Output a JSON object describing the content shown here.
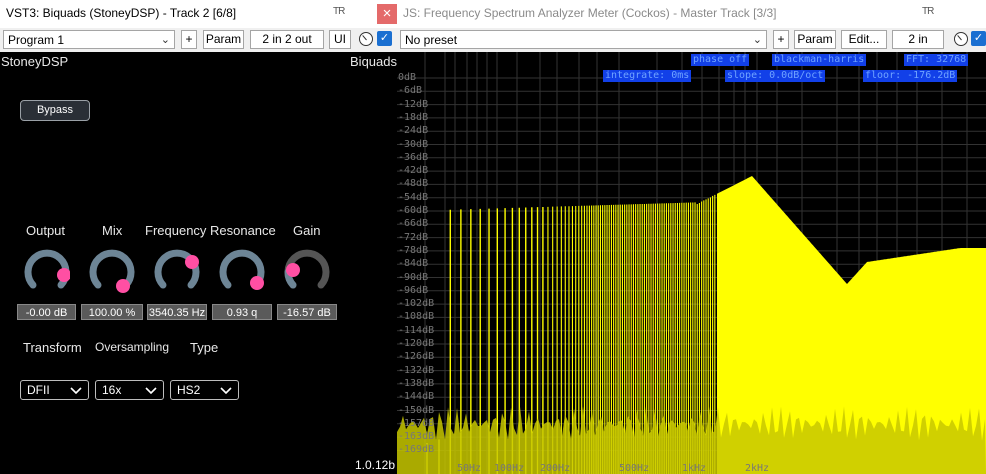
{
  "left_window": {
    "title": "VST3: Biquads (StoneyDSP) - Track 2 [6/8]",
    "pin_label": "TR",
    "close_label": "x",
    "program": "Program 1",
    "add_label": "+",
    "param_label": "Param",
    "io_label": "2 in 2 out",
    "ui_label": "UI",
    "vendor": "StoneyDSP",
    "plugin_name": "Biquads",
    "bypass_label": "Bypass",
    "knobs": [
      {
        "label": "Output",
        "value": "-0.00 dB"
      },
      {
        "label": "Mix",
        "value": "100.00 %"
      },
      {
        "label": "Frequency",
        "value": "3540.35 Hz"
      },
      {
        "label": "Resonance",
        "value": "0.93 q"
      },
      {
        "label": "Gain",
        "value": "-16.57 dB"
      }
    ],
    "dropdowns": [
      {
        "label": "Transform",
        "value": "DFII"
      },
      {
        "label": "Oversampling",
        "value": "16x"
      },
      {
        "label": "Type",
        "value": "HS2"
      }
    ],
    "version": "1.0.12b"
  },
  "right_window": {
    "title": "JS: Frequency Spectrum Analyzer Meter (Cockos) - Master Track [3/3]",
    "pin_label": "TR",
    "preset": "No preset",
    "add_label": "+",
    "param_label": "Param",
    "edit_label": "Edit...",
    "io_label": "2 in",
    "info": {
      "phase": "phase off",
      "window": "blackman-harris",
      "fft": "FFT: 32768",
      "integrate": "integrate: 0ms",
      "slope": "slope: 0.0dB/oct",
      "floor": "floor: -176.2dB"
    },
    "db_labels": [
      "0dB",
      "-6dB",
      "-12dB",
      "-18dB",
      "-24dB",
      "-30dB",
      "-36dB",
      "-42dB",
      "-48dB",
      "-54dB",
      "-60dB",
      "-66dB",
      "-72dB",
      "-78dB",
      "-84dB",
      "-90dB",
      "-96dB",
      "-102dB",
      "-108dB",
      "-114dB",
      "-120dB",
      "-126dB",
      "-132dB",
      "-138dB",
      "-144dB",
      "-150dB",
      "-157dB",
      "-163dB",
      "-169dB"
    ],
    "freq_labels": [
      "50Hz",
      "100Hz",
      "200Hz",
      "500Hz",
      "1kHz",
      "2kHz"
    ]
  },
  "colors": {
    "accent_pink": "#ff4fa3",
    "spectrum_yellow": "#ffff00",
    "info_blue": "#1240e8",
    "check_blue": "#1a6fd1"
  }
}
